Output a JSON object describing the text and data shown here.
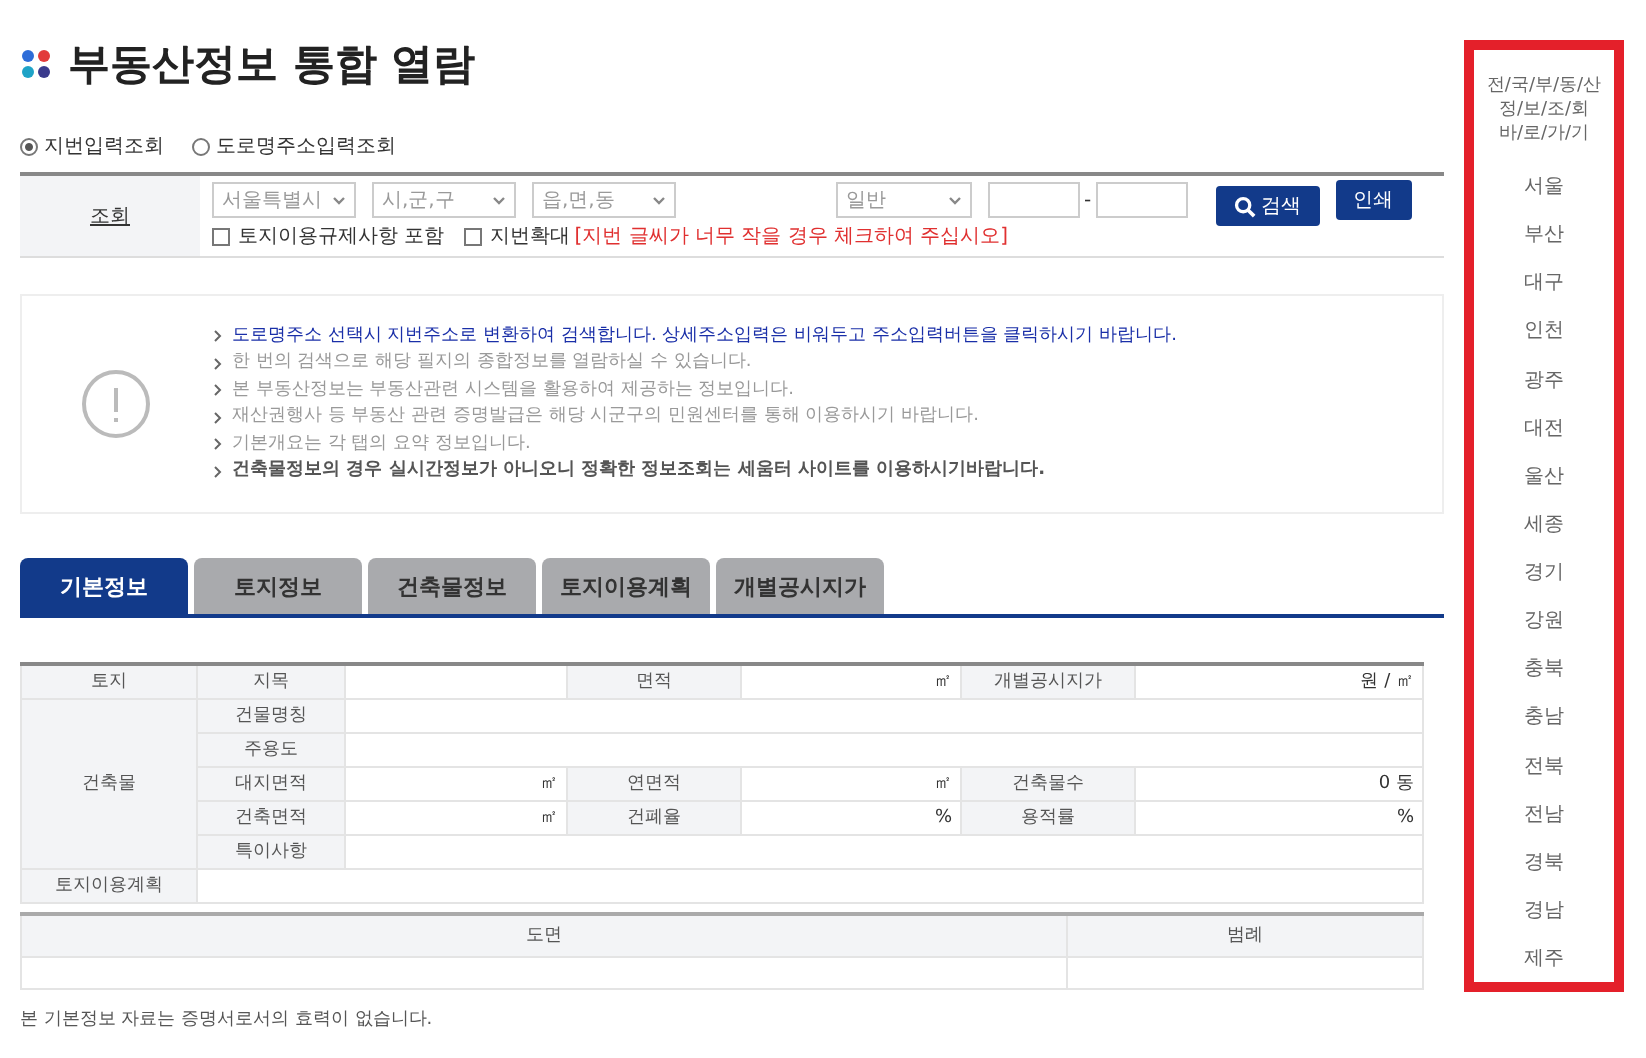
{
  "title": "부동산정보 통합 열람",
  "search_mode": [
    {
      "label": "지번입력조회",
      "selected": true
    },
    {
      "label": "도로명주소입력조회",
      "selected": false
    }
  ],
  "search": {
    "label": "조회",
    "selects": [
      "서울특별시",
      "시,군,구",
      "읍,면,동"
    ],
    "type_select": "일반",
    "dash": "-",
    "checkboxes": [
      {
        "label": "토지이용규제사항 포함",
        "checked": false
      },
      {
        "label": "지번확대",
        "checked": false
      }
    ],
    "note": "[지번 글씨가 너무 작을 경우 체크하여 주십시오]",
    "buttons": [
      {
        "label": "검색",
        "kind": "search"
      },
      {
        "label": "인쇄",
        "kind": "plain"
      }
    ]
  },
  "notices": [
    {
      "text": "도로명주소 선택시 지번주소로 변환하여 검색합니다. 상세주소입력은 비워두고 주소입력버튼을 클릭하시기 바랍니다.",
      "kind": "highlight"
    },
    {
      "text": "한 번의 검색으로 해당 필지의 종합정보를 열람하실 수 있습니다.",
      "kind": "normal"
    },
    {
      "text": "본 부동산정보는 부동산관련 시스템을 활용하여 제공하는 정보입니다.",
      "kind": "normal"
    },
    {
      "text": "재산권행사 등 부동산 관련 증명발급은 해당 시군구의 민원센터를 통해 이용하시기 바랍니다.",
      "kind": "normal"
    },
    {
      "text": "기본개요는 각 탭의 요약 정보입니다.",
      "kind": "normal"
    },
    {
      "text": "건축물정보의 경우 실시간정보가 아니오니 정확한 정보조회는 세움터 사이트를 이용하시기바랍니다.",
      "kind": "bold"
    }
  ],
  "tabs": [
    {
      "label": "기본정보",
      "selected": true
    },
    {
      "label": "토지정보",
      "selected": false
    },
    {
      "label": "건축물정보",
      "selected": false
    },
    {
      "label": "토지이용계획",
      "selected": false
    },
    {
      "label": "개별공시지가",
      "selected": false
    }
  ],
  "table": {
    "rows": [
      [
        {
          "text": "토지",
          "kind": "head"
        },
        {
          "text": "지목",
          "kind": "head"
        },
        {
          "text": "",
          "kind": "value"
        },
        {
          "text": "면적",
          "kind": "head"
        },
        {
          "text": "㎡",
          "kind": "value"
        },
        {
          "text": "개별공시지가",
          "kind": "head"
        },
        {
          "text": "원 / ㎡",
          "kind": "value"
        }
      ],
      [
        {
          "text": "건축물",
          "kind": "head",
          "rowspan": 5
        },
        {
          "text": "건물명칭",
          "kind": "head"
        },
        {
          "text": "",
          "kind": "value",
          "colspan": 5
        }
      ],
      [
        {
          "text": "주용도",
          "kind": "head"
        },
        {
          "text": "",
          "kind": "value",
          "colspan": 5
        }
      ],
      [
        {
          "text": "대지면적",
          "kind": "head"
        },
        {
          "text": "㎡",
          "kind": "value"
        },
        {
          "text": "연면적",
          "kind": "head"
        },
        {
          "text": "㎡",
          "kind": "value"
        },
        {
          "text": "건축물수",
          "kind": "head"
        },
        {
          "text": "0 동",
          "kind": "value"
        }
      ],
      [
        {
          "text": "건축면적",
          "kind": "head"
        },
        {
          "text": "㎡",
          "kind": "value"
        },
        {
          "text": "건폐율",
          "kind": "head"
        },
        {
          "text": "%",
          "kind": "value"
        },
        {
          "text": "용적률",
          "kind": "head"
        },
        {
          "text": "%",
          "kind": "value"
        }
      ],
      [
        {
          "text": "특이사항",
          "kind": "head"
        },
        {
          "text": "",
          "kind": "value",
          "colspan": 5
        }
      ],
      [
        {
          "text": "토지이용계획",
          "kind": "head"
        },
        {
          "text": "",
          "kind": "value",
          "colspan": 6
        }
      ]
    ]
  },
  "map_table": {
    "columns": [
      "도면",
      "범례"
    ]
  },
  "footnote": "본 기본정보 자료는 증명서로서의 효력이 없습니다.",
  "sidebar": {
    "title_lines": [
      "전/국/부/동/산",
      "정/보/조/회",
      "바/로/가/기"
    ],
    "items": [
      "서울",
      "부산",
      "대구",
      "인천",
      "광주",
      "대전",
      "울산",
      "세종",
      "경기",
      "강원",
      "충북",
      "충남",
      "전북",
      "전남",
      "경북",
      "경남",
      "제주"
    ]
  }
}
